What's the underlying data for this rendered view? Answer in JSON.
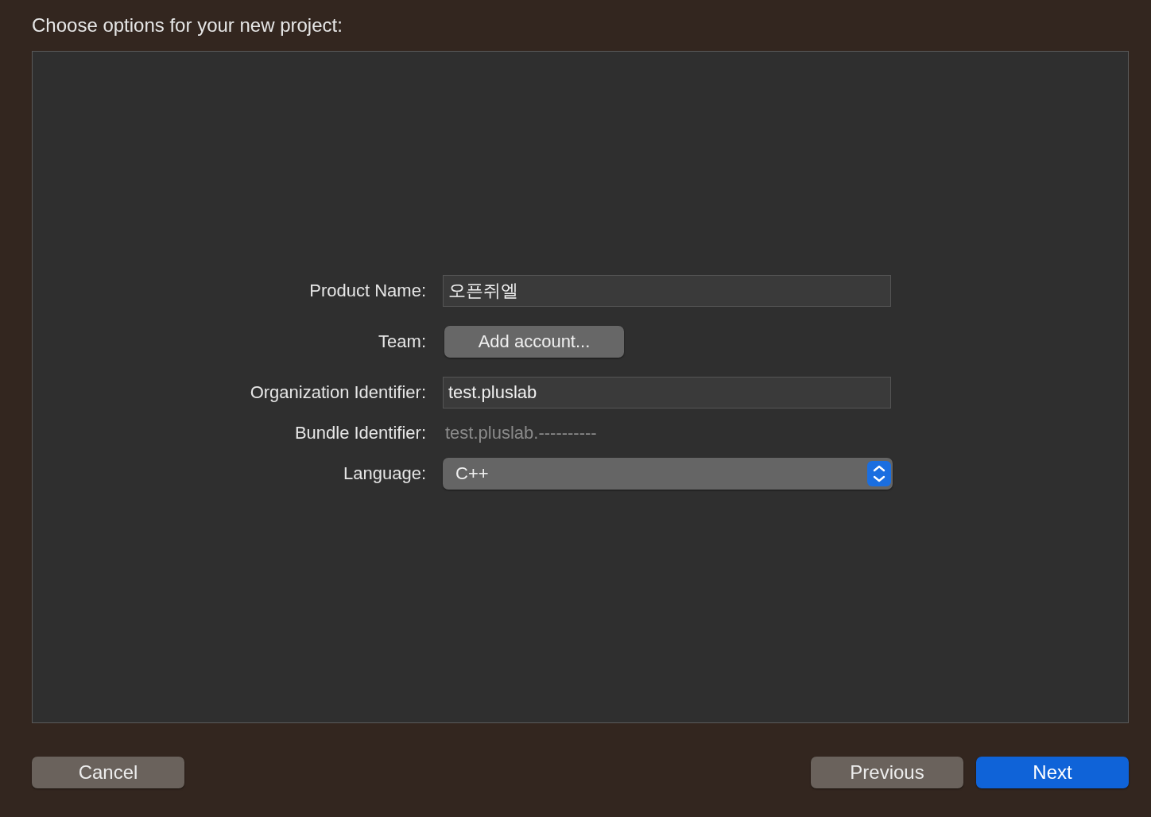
{
  "window": {
    "title": "Choose options for your new project:"
  },
  "form": [
    {
      "kind": "text",
      "label": "Product Name:",
      "value": "오픈쥐엘"
    },
    {
      "kind": "button",
      "label": "Team:",
      "value": "Add account..."
    },
    {
      "kind": "text",
      "label": "Organization Identifier:",
      "value": "test.pluslab"
    },
    {
      "kind": "static",
      "label": "Bundle Identifier:",
      "value": "test.pluslab.----------"
    },
    {
      "kind": "popup",
      "label": "Language:",
      "value": "C++"
    }
  ],
  "buttons": [
    {
      "label": "Cancel",
      "kind": "secondary"
    },
    {
      "label": "Previous",
      "kind": "secondary"
    },
    {
      "label": "Next",
      "kind": "primary"
    }
  ]
}
